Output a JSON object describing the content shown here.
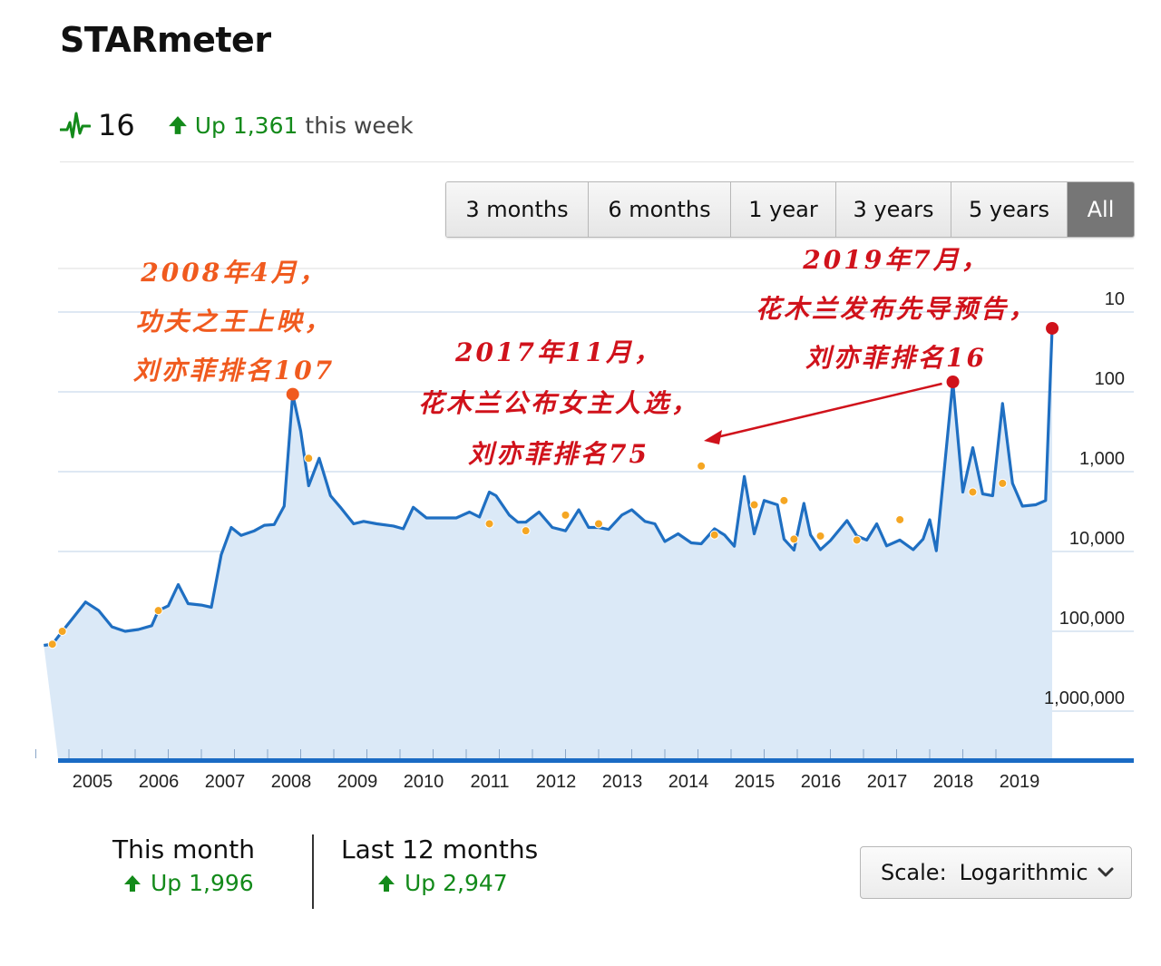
{
  "header": {
    "title": "STARmeter",
    "rank": "16",
    "delta": "Up 1,361",
    "delta_suffix": "this week"
  },
  "ranges": [
    {
      "label": "3 months",
      "active": false
    },
    {
      "label": "6 months",
      "active": false
    },
    {
      "label": "1 year",
      "active": false
    },
    {
      "label": "3 years",
      "active": false
    },
    {
      "label": "5 years",
      "active": false
    },
    {
      "label": "All",
      "active": true
    }
  ],
  "stats": {
    "month_label": "This month",
    "month_value": "Up 1,996",
    "year_label": "Last 12 months",
    "year_value": "Up 2,947"
  },
  "scale": {
    "label": "Scale:",
    "value": "Logarithmic"
  },
  "colors": {
    "line": "#1f6fc2",
    "area": "#dbe9f7",
    "marker": "#f5a623",
    "accent_green": "#138a1a",
    "ann_orange": "#f05a1e",
    "ann_red": "#d0121b",
    "selected": "#767676"
  },
  "chart_data": {
    "type": "area",
    "yscale": "log",
    "yinvert": true,
    "ylim": [
      10,
      1000000
    ],
    "yticks": [
      10,
      100,
      1000,
      10000,
      100000,
      1000000
    ],
    "ytick_labels": [
      "10",
      "100",
      "1,000",
      "10,000",
      "100,000",
      "1,000,000"
    ],
    "xlim": [
      2004.6,
      2020.0
    ],
    "xticks": [
      2005,
      2006,
      2007,
      2008,
      2009,
      2010,
      2011,
      2012,
      2013,
      2014,
      2015,
      2016,
      2017,
      2018,
      2019
    ],
    "xtick_labels": [
      "2005",
      "2006",
      "2007",
      "2008",
      "2009",
      "2010",
      "2011",
      "2012",
      "2013",
      "2014",
      "2015",
      "2016",
      "2017",
      "2018",
      "2019"
    ],
    "grid": true,
    "series": [
      {
        "points": [
          [
            2004.62,
            150000
          ],
          [
            2004.75,
            145000
          ],
          [
            2004.9,
            100000
          ],
          [
            2005.05,
            70000
          ],
          [
            2005.25,
            43000
          ],
          [
            2005.45,
            55000
          ],
          [
            2005.65,
            88000
          ],
          [
            2005.85,
            100000
          ],
          [
            2006.05,
            95000
          ],
          [
            2006.25,
            85000
          ],
          [
            2006.35,
            55000
          ],
          [
            2006.5,
            48000
          ],
          [
            2006.65,
            26000
          ],
          [
            2006.8,
            45000
          ],
          [
            2007.0,
            47000
          ],
          [
            2007.15,
            50000
          ],
          [
            2007.3,
            11000
          ],
          [
            2007.45,
            5000
          ],
          [
            2007.6,
            6300
          ],
          [
            2007.8,
            5500
          ],
          [
            2007.95,
            4700
          ],
          [
            2008.1,
            4600
          ],
          [
            2008.25,
            2700
          ],
          [
            2008.38,
            107
          ],
          [
            2008.5,
            310
          ],
          [
            2008.62,
            1500
          ],
          [
            2008.78,
            680
          ],
          [
            2008.95,
            2000
          ],
          [
            2009.1,
            2800
          ],
          [
            2009.3,
            4500
          ],
          [
            2009.45,
            4200
          ],
          [
            2009.65,
            4500
          ],
          [
            2009.9,
            4800
          ],
          [
            2010.05,
            5200
          ],
          [
            2010.2,
            2800
          ],
          [
            2010.4,
            3800
          ],
          [
            2010.6,
            3800
          ],
          [
            2010.85,
            3800
          ],
          [
            2011.05,
            3200
          ],
          [
            2011.2,
            3700
          ],
          [
            2011.35,
            1800
          ],
          [
            2011.45,
            2000
          ],
          [
            2011.65,
            3500
          ],
          [
            2011.78,
            4300
          ],
          [
            2011.9,
            4300
          ],
          [
            2012.1,
            3200
          ],
          [
            2012.3,
            5000
          ],
          [
            2012.5,
            5500
          ],
          [
            2012.7,
            3000
          ],
          [
            2012.85,
            5000
          ],
          [
            2013.0,
            5000
          ],
          [
            2013.15,
            5300
          ],
          [
            2013.35,
            3500
          ],
          [
            2013.5,
            3000
          ],
          [
            2013.7,
            4200
          ],
          [
            2013.85,
            4500
          ],
          [
            2014.0,
            7500
          ],
          [
            2014.2,
            6000
          ],
          [
            2014.4,
            7800
          ],
          [
            2014.55,
            8000
          ],
          [
            2014.75,
            5200
          ],
          [
            2014.9,
            6200
          ],
          [
            2015.05,
            8600
          ],
          [
            2015.2,
            1150
          ],
          [
            2015.35,
            6000
          ],
          [
            2015.5,
            2300
          ],
          [
            2015.7,
            2600
          ],
          [
            2015.8,
            7000
          ],
          [
            2015.95,
            9600
          ],
          [
            2016.1,
            2500
          ],
          [
            2016.2,
            6200
          ],
          [
            2016.35,
            9500
          ],
          [
            2016.5,
            7300
          ],
          [
            2016.75,
            4100
          ],
          [
            2016.9,
            6400
          ],
          [
            2017.05,
            7200
          ],
          [
            2017.2,
            4500
          ],
          [
            2017.35,
            8500
          ],
          [
            2017.55,
            7200
          ],
          [
            2017.75,
            9500
          ],
          [
            2017.9,
            7000
          ],
          [
            2018.0,
            4000
          ],
          [
            2018.1,
            9800
          ],
          [
            2018.35,
            75
          ],
          [
            2018.5,
            1800
          ],
          [
            2018.65,
            500
          ],
          [
            2018.8,
            1900
          ],
          [
            2018.95,
            2000
          ],
          [
            2019.1,
            140
          ],
          [
            2019.25,
            1400
          ],
          [
            2019.4,
            2700
          ],
          [
            2019.6,
            2600
          ],
          [
            2019.75,
            2300
          ],
          [
            2019.85,
            16
          ]
        ]
      }
    ],
    "markers": [
      [
        2004.75,
        145000
      ],
      [
        2004.9,
        100000
      ],
      [
        2006.35,
        55000
      ],
      [
        2008.62,
        680
      ],
      [
        2011.35,
        4500
      ],
      [
        2011.9,
        5500
      ],
      [
        2012.5,
        3500
      ],
      [
        2013.0,
        4500
      ],
      [
        2014.55,
        850
      ],
      [
        2014.75,
        6200
      ],
      [
        2015.35,
        2600
      ],
      [
        2015.8,
        2300
      ],
      [
        2015.95,
        7000
      ],
      [
        2016.35,
        6400
      ],
      [
        2016.9,
        7200
      ],
      [
        2017.55,
        4000
      ],
      [
        2018.65,
        1800
      ],
      [
        2019.1,
        1400
      ]
    ],
    "highlights": [
      [
        2008.38,
        107
      ],
      [
        2018.35,
        75
      ],
      [
        2019.85,
        16
      ]
    ],
    "annotations": [
      {
        "lines": [
          "2008年4月，",
          "功夫之王上映，",
          "刘亦菲排名107"
        ],
        "color": "#f05a1e"
      },
      {
        "lines": [
          "2017年11月，",
          "花木兰公布女主人选，",
          "刘亦菲排名75"
        ],
        "color": "#d0121b"
      },
      {
        "lines": [
          "2019年7月，",
          "花木兰发布先导预告，",
          "刘亦菲排名16"
        ],
        "color": "#d0121b"
      }
    ]
  }
}
